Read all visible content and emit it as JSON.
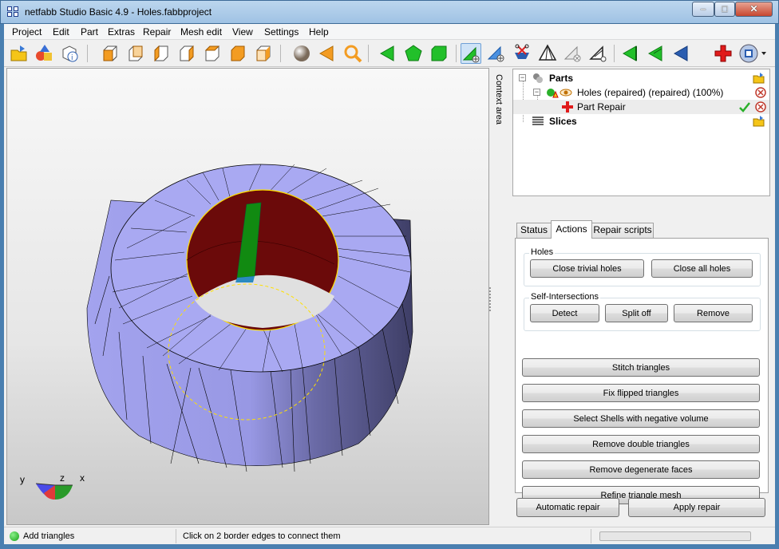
{
  "window": {
    "title": "netfabb Studio Basic 4.9 - Holes.fabbproject"
  },
  "menu": [
    "Project",
    "Edit",
    "Part",
    "Extras",
    "Repair",
    "Mesh edit",
    "View",
    "Settings",
    "Help"
  ],
  "toolbar_icons": [
    "open-project-icon",
    "add-part-icon",
    "part-info-icon",
    "view-front-icon",
    "view-back-icon",
    "view-left-icon",
    "view-right-icon",
    "view-top-icon",
    "view-bottom-icon",
    "view-perspective-icon",
    "sphere-icon",
    "cone-icon",
    "zoom-icon",
    "select-triangle-icon",
    "select-surface-icon",
    "select-shell-icon",
    "add-triangles-icon",
    "split-triangles-icon",
    "cut-icon",
    "tetra-icon",
    "remove-triangles-icon",
    "smooth-icon",
    "arrow-green-icon",
    "arrow-green-2-icon",
    "arrow-blue-icon",
    "repair-cross-icon",
    "shield-icon"
  ],
  "context_area_label": "Context area",
  "tree": {
    "parts_label": "Parts",
    "part_label": "Holes (repaired) (repaired) (100%)",
    "repair_label": "Part Repair",
    "slices_label": "Slices"
  },
  "tabs": [
    "Status",
    "Actions",
    "Repair scripts"
  ],
  "active_tab": "Actions",
  "actions": {
    "holes_title": "Holes",
    "close_trivial": "Close trivial holes",
    "close_all": "Close all holes",
    "self_int_title": "Self-Intersections",
    "detect": "Detect",
    "split_off": "Split off",
    "remove": "Remove",
    "stitch": "Stitch triangles",
    "fix_flipped": "Fix flipped triangles",
    "select_shells": "Select Shells with negative volume",
    "remove_double": "Remove double triangles",
    "remove_degenerate": "Remove degenerate faces",
    "refine": "Refine triangle mesh"
  },
  "bottom_buttons": {
    "automatic_repair": "Automatic repair",
    "apply_repair": "Apply repair"
  },
  "status": {
    "mode": "Add triangles",
    "hint": "Click on 2 border edges to connect them",
    "progress_fraction": 0
  },
  "axis": {
    "x": "x",
    "y": "y",
    "z": "z"
  },
  "colors": {
    "mesh_top": "#a9a9f2",
    "mesh_side": "#9c9ce8",
    "mesh_side_dark": "#52527a",
    "inner_red": "#6b0a0a",
    "selection_green": "#118a11",
    "hole_border": "#ffe000"
  }
}
